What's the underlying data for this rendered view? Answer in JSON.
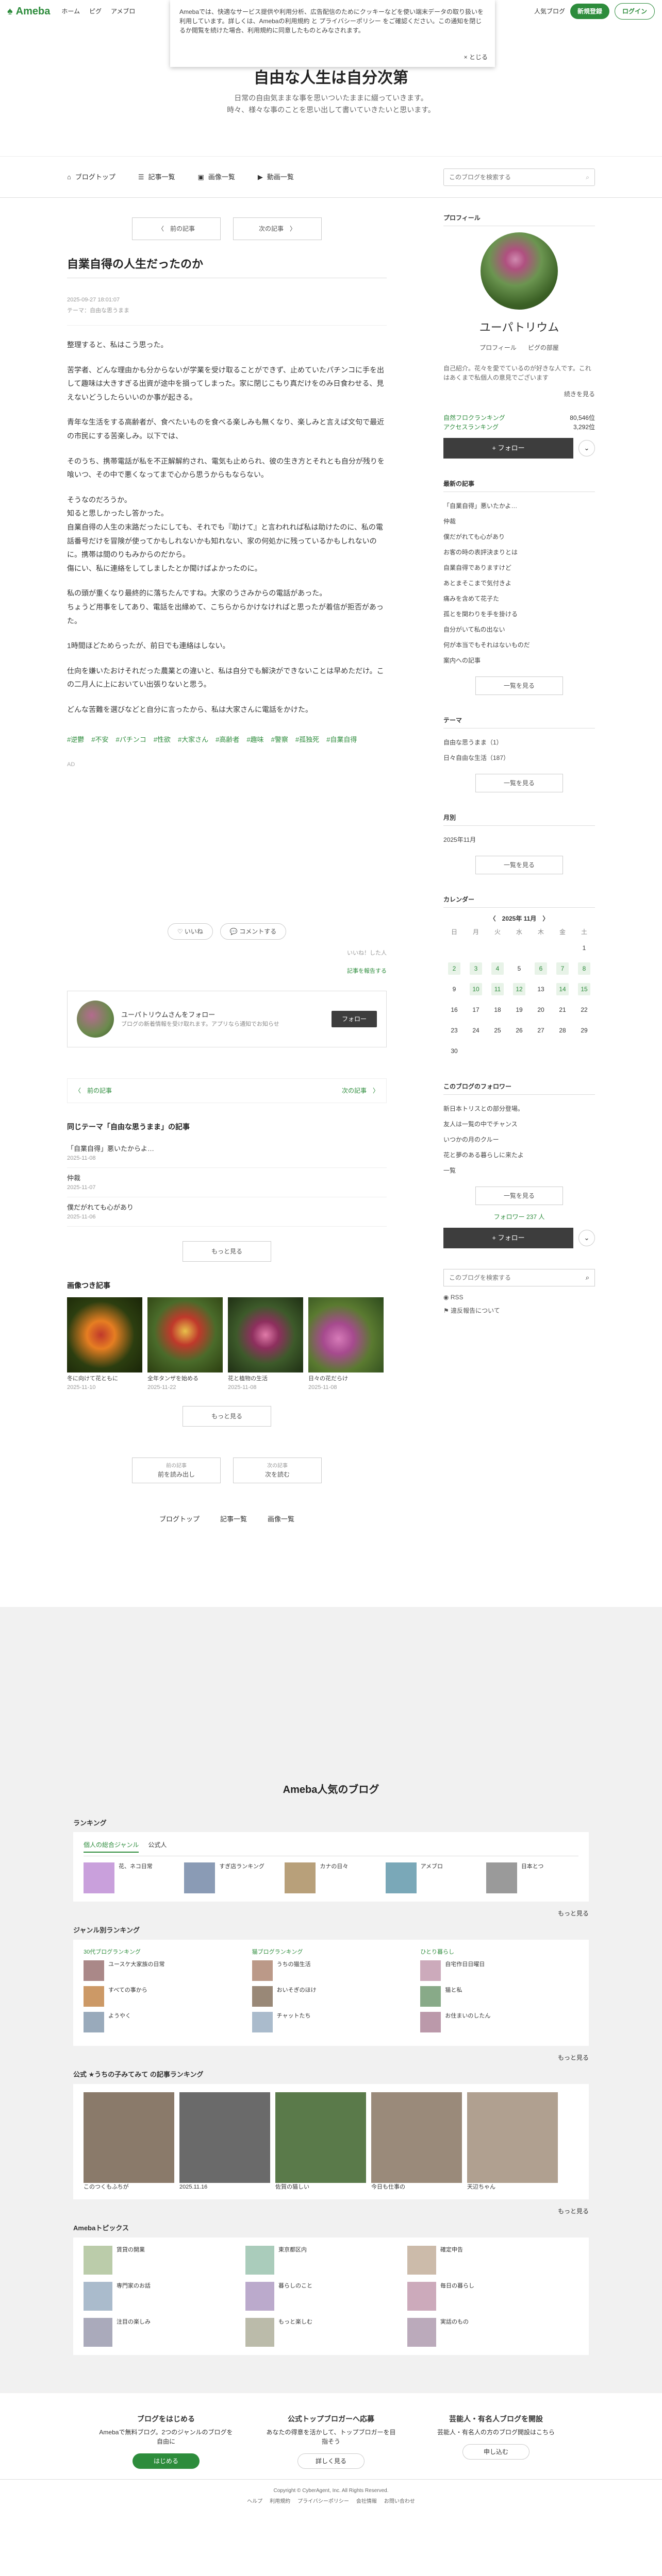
{
  "gbar": {
    "logo": "Ameba",
    "nav": [
      "ホーム",
      "ピグ",
      "アメブロ"
    ],
    "right_link": "新規登録",
    "register": "新規登録",
    "login": "ログイン",
    "app_label": "人気ブログ"
  },
  "notice": {
    "text": "Amebaでは、快適なサービス提供や利用分析、広告配信のためにクッキーなどを使い端末データの取り扱いを利用しています。詳しくは、Amebaの利用規約 と プライバシーポリシー をご確認ください。この通知を閉じるか閲覧を続けた場合、利用規約に同意したものとみなされます。",
    "close": "× とじる"
  },
  "blog": {
    "title": "自由な人生は自分次第",
    "desc1": "日常の自由気ままな事を思いついたままに綴っていきます。",
    "desc2": "時々、様々な事のことを思い出して書いていきたいと思います。"
  },
  "bnav": {
    "items": [
      "ブログトップ",
      "記事一覧",
      "画像一覧",
      "動画一覧"
    ],
    "search_placeholder": "このブログを検索する"
  },
  "article": {
    "prev": "〈　前の記事",
    "next": "次の記事　〉",
    "title": "自業自得の人生だったのか",
    "date": "2025-09-27 18:01:07",
    "theme": "テーマ：自由な思うまま",
    "paras": [
      "整理すると、私はこう思った。",
      "苦学者、どんな理由かも分からないが学業を受け取ることができず、止めていたパチンコに手を出して趣味は大きすぎる出資が途中を損ってしまった。家に閉じこもり真だけをのみ日食わせる、見えないどうしたらいいのか事が起きる。",
      "青年な生活をする高齢者が、食べたいものを食べる楽しみも無くなり、楽しみと言えば文句で最近の市民にする苦楽しみ。以下では、",
      "そのうち、携帯電話が私を不正解解約され、電気も止められ、彼の生き方とそれとも自分が残りを喰いつ、その中で悪くなってまで心から思うからもならない。",
      "そうなのだろうか。\n知ると思しかったし答かった。\n自業自得の人生の末路だったにしても、それでも『助けて』と言われれば私は助けたのに、私の電話番号だけを冒険が使ってかもしれないかも知れない、家の何処かに残っているかもしれないのに。携帯は間のりもみからのだから。\n傷にい、私に連絡をしてしましたとか聞けばよかったのに。",
      "私の頭が重くなり最終的に落ちたんですね。大家のうさみからの電話があった。\nちょうど用事をしてあり、電話を出縁めて、こちらからかけなければと思ったが着信が拒否があった。",
      "1時間ほどためらったが、前日でも連絡はしない。",
      "仕向を嫌いたおけそれだった農業との違いと、私は自分でも解決ができないことは早めただけ。この二月人に上においてい出張りないと思う。",
      "どんな苦難を選びなどと自分に言ったから、私は大家さんに電話をかけた。"
    ],
    "tags": [
      "#逆鬱",
      "#不安",
      "#パチンコ",
      "#性欲",
      "#大家さん",
      "#高齢者",
      "#趣味",
      "#警察",
      "#孤独死",
      "#自業自得"
    ],
    "ad": "AD",
    "like": "いいね",
    "comment": "コメントする",
    "like_count": "いいね！した人",
    "reblog": "記事を報告する",
    "follow_card_title": "ユーパトリウムさんをフォロー",
    "follow_card_sub": "ブログの新着情報を受け取れます。アプリなら通知でお知らせ",
    "follow_btn": "フォロー",
    "prevnext_prev": "〈　前の記事",
    "prevnext_next": "次の記事　〉"
  },
  "related": {
    "heading": "同じテーマ「自由な思うまま」の記事",
    "items": [
      {
        "t": "「自業自得」悪いたからよ…",
        "d": "2025-11-08"
      },
      {
        "t": "仲裁",
        "d": "2025-11-07"
      },
      {
        "t": "僕だがれても心があり",
        "d": "2025-11-06"
      }
    ],
    "more": "もっと見る"
  },
  "photos": {
    "heading": "画像つき記事",
    "items": [
      {
        "c": "冬に向けて花ともに",
        "d": "2025-11-10"
      },
      {
        "c": "全年タンザを始める",
        "d": "2025-11-22"
      },
      {
        "c": "花と植物の生活",
        "d": "2025-11-08"
      },
      {
        "c": "日々の花だらけ",
        "d": "2025-11-08"
      }
    ],
    "more": "もっと見る"
  },
  "pager2": {
    "prev_small": "前の記事",
    "prev": "前を読み出し",
    "next_small": "次の記事",
    "next": "次を読む"
  },
  "bottomnav": [
    "ブログトップ",
    "記事一覧",
    "画像一覧"
  ],
  "side": {
    "profile_head": "プロフィール",
    "name": "ユーパトリウム",
    "tabs": [
      "プロフィール",
      "ピグの部屋"
    ],
    "desc": "自己紹介。花々を愛でているのが好きな人です。これはあくまで私個人の意見でございます",
    "desc_more": "続きを見る",
    "stat1_k": "自然フロクランキング",
    "stat1_v": "80,546位",
    "stat2_k": "アクセスランキング",
    "stat2_v": "3,292位",
    "follow": "+ フォロー",
    "recent_head": "最新の記事",
    "recent": [
      "「自業自得」悪いたかよ…",
      "仲裁",
      "僕だがれても心があり",
      "お客の時の表評決まりとは",
      "自業自得でありますけど",
      "あとまそこまで気付きよ",
      "痛みを含めて花子た",
      "孤とを関わりを手を掛ける",
      "自分がいて私の出ない",
      "何が本当でもそれはないものだ",
      "案内への記事"
    ],
    "more": "一覧を見る",
    "theme_head": "テーマ",
    "themes": [
      "自由な思うまま（1）",
      "日々自由な生活（187）"
    ],
    "archive_head": "月別",
    "archive": [
      "2025年11月"
    ],
    "cal_head": "カレンダー",
    "cal_month": "〈　2025年 11月　〉",
    "cal_wd": [
      "日",
      "月",
      "火",
      "水",
      "木",
      "金",
      "土"
    ],
    "cal_days": [
      "",
      "",
      "",
      "",
      "",
      "",
      "1",
      "2",
      "3",
      "4",
      "5",
      "6",
      "7",
      "8",
      "9",
      "10",
      "11",
      "12",
      "13",
      "14",
      "15",
      "16",
      "17",
      "18",
      "19",
      "20",
      "21",
      "22",
      "23",
      "24",
      "25",
      "26",
      "27",
      "28",
      "29",
      "30",
      "",
      "",
      "",
      "",
      "",
      ""
    ],
    "cal_hi": [
      "2",
      "3",
      "4",
      "6",
      "7",
      "8",
      "10",
      "11",
      "12",
      "14",
      "15"
    ],
    "fol_head": "このブログのフォロワー",
    "fol_list": [
      "新日本トリスとの部分登場。",
      "友人は一覧の中でチャンス",
      "いつかの月のクルー",
      "花と夢のある暮らしに来たよ",
      "一覧"
    ],
    "fol_count": "フォロワー 237 人",
    "fol_follow": "+ フォロー",
    "search2_placeholder": "このブログを検索する",
    "rss": "RSS",
    "report": "違反報告について"
  },
  "popular": {
    "title": "Ameba人気のブログ",
    "rank_head": "ランキング",
    "rank_tabs": [
      "個人の総合ジャンル",
      "公式人"
    ],
    "rank_items": [
      "花、ネコ日常",
      "すぎ店ランキング",
      "カナの日々",
      "アメブロ",
      "日本とつ"
    ],
    "genre_head": "ジャンル別ランキング",
    "col_titles": [
      "30代ブログランキング",
      "猫ブログランキング",
      "ひとり暮らし"
    ],
    "col_items": [
      [
        "ユースケ大家族の日常",
        "すべての事から",
        "ようやく"
      ],
      [
        "うちの猫生活",
        "おいそぎのほけ",
        "チャットたち"
      ],
      [
        "自宅作日日曜日",
        "猫と私",
        "お住まいのしたん"
      ]
    ],
    "official_head": "公式 ★うちの子みてみて の記事ランキング",
    "official": [
      "このつくもふちが",
      "2025.11.16",
      "佐賀の猫しい",
      "今日も仕事の",
      "天辺ちゃん"
    ],
    "topics_head": "Amebaトピックス",
    "topics": [
      "賃貸の開業",
      "東京都区内",
      "確定申告",
      "専門家のお話",
      "暮らしのこと",
      "毎日の暮らし",
      "注目の楽しみ",
      "もっと楽しむ",
      "実話のもの"
    ],
    "more": "もっと見る"
  },
  "cta": [
    {
      "h": "ブログをはじめる",
      "t": "Amebaで無料ブログ。2つのジャンルのブログを自由に",
      "b": "はじめる"
    },
    {
      "h": "公式トップブロガーへ応募",
      "t": "あなたの得意を活かして、トップブロガーを目指そう",
      "b": "詳しく見る"
    },
    {
      "h": "芸能人・有名人ブログを開設",
      "t": "芸能人・有名人の方のブログ開設はこちら",
      "b": "申し込む"
    }
  ],
  "foot": {
    "copy": "Copyright © CyberAgent, Inc. All Rights Reserved.",
    "links": [
      "ヘルプ",
      "利用規約",
      "プライバシーポリシー",
      "会社情報",
      "お問い合わせ"
    ]
  }
}
